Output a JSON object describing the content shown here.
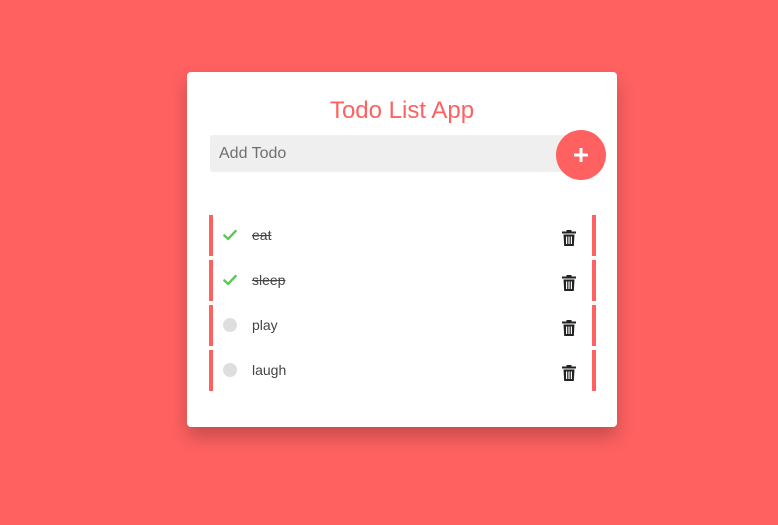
{
  "app": {
    "title": "Todo List App"
  },
  "add_todo": {
    "placeholder": "Add Todo",
    "value": ""
  },
  "todos": [
    {
      "text": "eat",
      "completed": true
    },
    {
      "text": "sleep",
      "completed": true
    },
    {
      "text": "play",
      "completed": false
    },
    {
      "text": "laugh",
      "completed": false
    }
  ],
  "icons": {
    "add": "plus-icon",
    "completed": "check-icon",
    "incomplete": "circle-icon",
    "delete": "trash-icon"
  },
  "colors": {
    "background": "#ff6161",
    "accent": "#ff6161",
    "check": "#5cc659",
    "card": "#ffffff",
    "input_bg": "#efefef"
  }
}
